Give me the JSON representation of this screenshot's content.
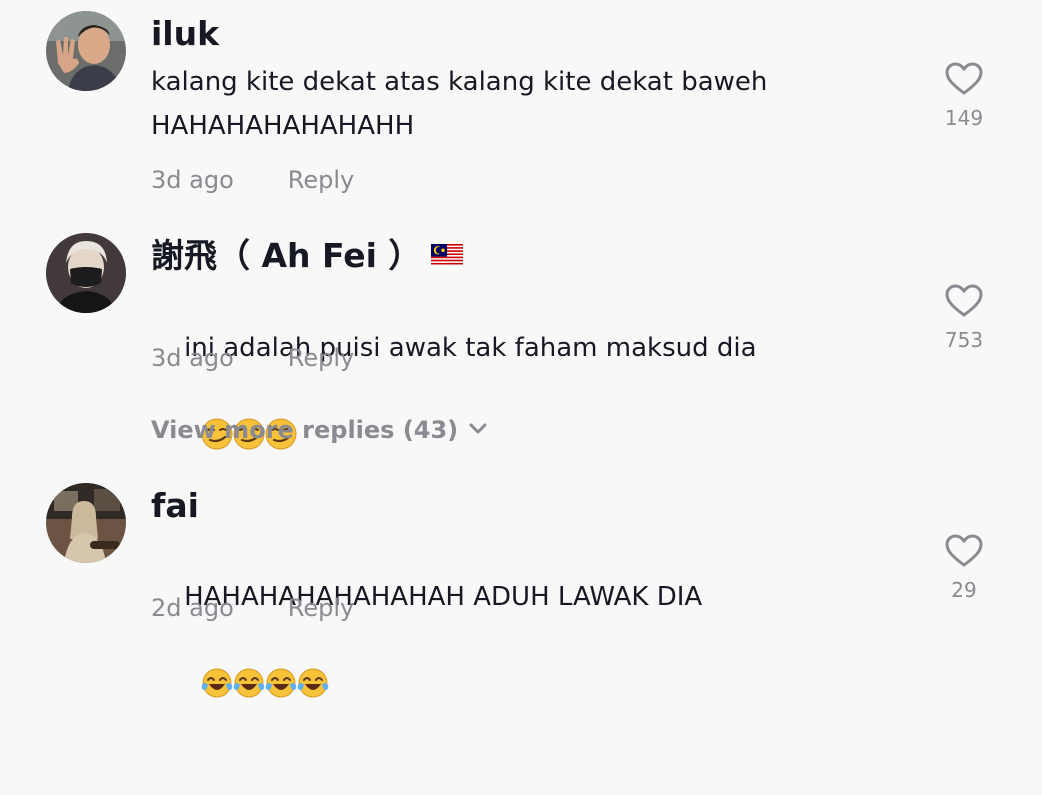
{
  "comments": [
    {
      "username": "iluk",
      "text": "kalang kite dekat atas kalang kite dekat baweh HAHAHAHAHAHAHH",
      "time": "3d ago",
      "reply_label": "Reply",
      "likes": "149"
    },
    {
      "username": "謝飛（ Ah Fei ）",
      "flag_icon": "malaysia-flag-icon",
      "text": "ini adalah puisi awak tak faham maksud dia",
      "emoji_icon": "smirking-face-emoji",
      "emoji_count": 3,
      "time": "3d ago",
      "reply_label": "Reply",
      "likes": "753"
    },
    {
      "username": "fai",
      "text": "HAHAHAHAHAHAHAH ADUH LAWAK DIA",
      "emoji_icon": "tears-of-joy-emoji",
      "emoji_count": 4,
      "time": "2d ago",
      "reply_label": "Reply",
      "likes": "29"
    }
  ],
  "view_more": {
    "label": "View more replies (43)",
    "icon": "chevron-down-icon"
  },
  "colors": {
    "background": "#f8f8f8",
    "primary_text": "#161823",
    "secondary_text": "#8a8b91"
  }
}
